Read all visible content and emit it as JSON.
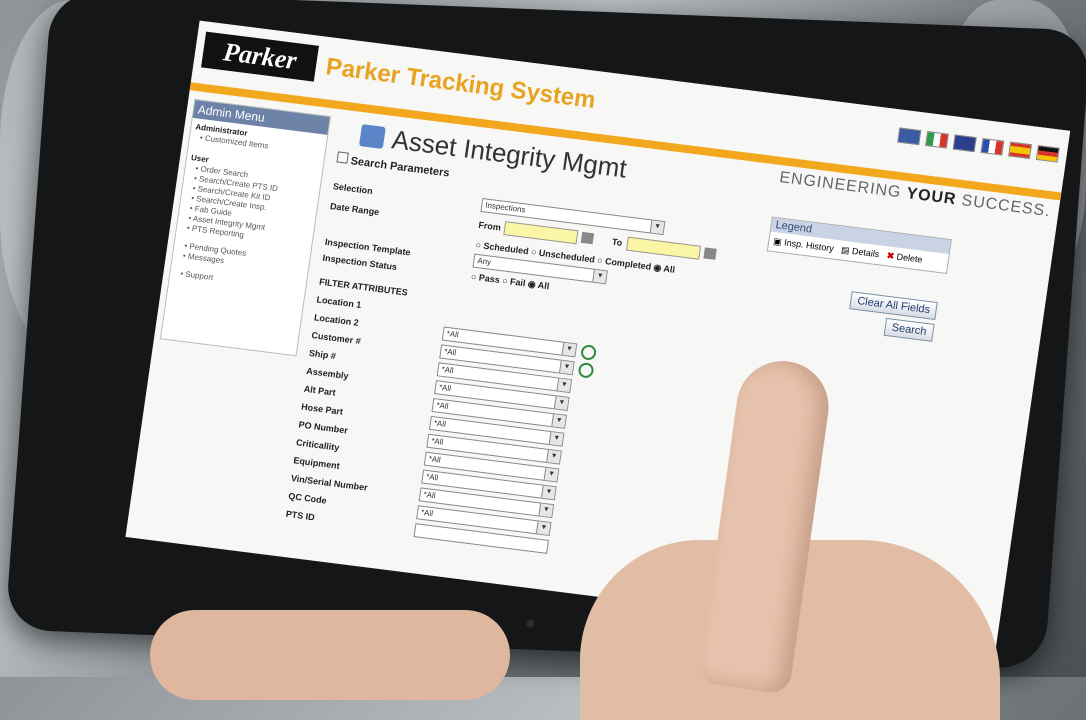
{
  "header": {
    "logo": "Parker",
    "app_title": "Parker Tracking System",
    "tagline_pre": "ENGINEERING ",
    "tagline_bold": "YOUR",
    "tagline_post": " SUCCESS."
  },
  "flags": [
    {
      "name": "usa-flag-icon",
      "color": "#3b5ba5"
    },
    {
      "name": "italy-flag-icon",
      "color": "#2e9a4a"
    },
    {
      "name": "uk-flag-icon",
      "color": "#2c3f8f"
    },
    {
      "name": "france-flag-icon",
      "color": "#2b4fb0"
    },
    {
      "name": "spain-flag-icon",
      "color": "#d8352a"
    },
    {
      "name": "germany-flag-icon",
      "color": "#d9a021"
    }
  ],
  "sidebar": {
    "title": "Admin Menu",
    "administrator": "Administrator",
    "admin_items": [
      "Customized Items"
    ],
    "user": "User",
    "user_items": [
      "Order Search",
      "Search/Create PTS ID",
      "Search/Create Kit ID",
      "Search/Create Insp.",
      "Fab Guide",
      "Asset Integrity Mgmt",
      "PTS Reporting"
    ],
    "more_items": [
      "Pending Quotes",
      "Messages"
    ],
    "support": "Support"
  },
  "main": {
    "title": "Asset Integrity Mgmt",
    "section": "Search Parameters",
    "labels": {
      "selection": "Selection",
      "date_range": "Date Range",
      "from": "From",
      "to": "To",
      "inspection_template": "Inspection Template",
      "inspection_status": "Inspection Status",
      "filter_attributes": "FILTER ATTRIBUTES"
    },
    "selection_value": "Inspections",
    "template_value": "Any",
    "schedule_radios": [
      "Scheduled",
      "Unscheduled",
      "Completed",
      "All"
    ],
    "status_radios": [
      "Pass",
      "Fail",
      "All"
    ],
    "filters": [
      {
        "label": "Location 1",
        "value": "*All"
      },
      {
        "label": "Location 2",
        "value": "*All"
      },
      {
        "label": "Customer #",
        "value": "*All"
      },
      {
        "label": "Ship #",
        "value": "*All"
      },
      {
        "label": "Assembly",
        "value": "*All"
      },
      {
        "label": "Alt Part",
        "value": "*All"
      },
      {
        "label": "Hose Part",
        "value": "*All"
      },
      {
        "label": "PO Number",
        "value": "*All"
      },
      {
        "label": "Criticallity",
        "value": "*All"
      },
      {
        "label": "Equipment",
        "value": "*All"
      },
      {
        "label": "Vin/Serial Number",
        "value": "*All"
      },
      {
        "label": "QC Code",
        "value": "*All"
      },
      {
        "label": "PTS ID",
        "value": ""
      }
    ],
    "buttons": {
      "clear": "Clear All Fields",
      "search": "Search"
    },
    "legend": {
      "title": "Legend",
      "history": "Insp. History",
      "details": "Details",
      "delete": "Delete"
    }
  }
}
